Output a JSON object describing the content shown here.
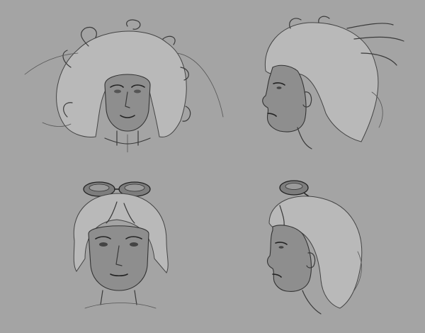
{
  "artwork": {
    "background_color": "#a4a4a4",
    "line_color": "#3a3a3a",
    "skin_shade": "#8e8e8e",
    "hair_shade": "#b9b9b9",
    "sketches": [
      {
        "subject": "curly-hair-front",
        "view": "front"
      },
      {
        "subject": "curly-hair-profile",
        "view": "profile-left"
      },
      {
        "subject": "goggles-front",
        "view": "front"
      },
      {
        "subject": "goggles-profile",
        "view": "profile-left"
      }
    ]
  }
}
